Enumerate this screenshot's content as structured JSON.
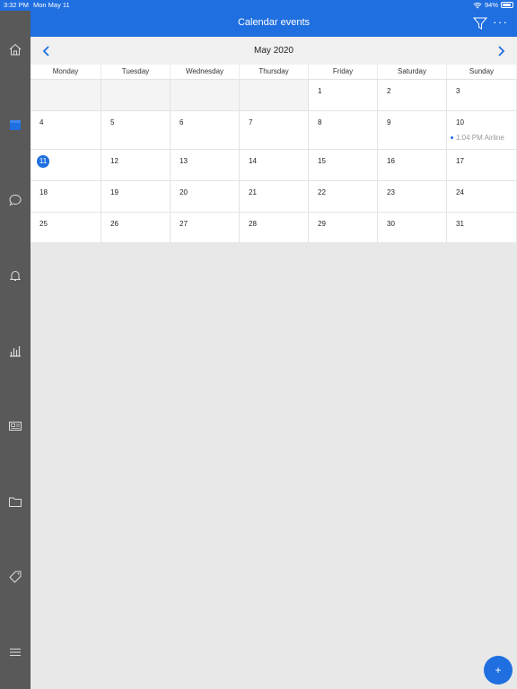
{
  "status": {
    "time": "3:32 PM",
    "date": "Mon May 11",
    "battery": "94%",
    "battery_level": 0.94
  },
  "header": {
    "title": "Calendar events"
  },
  "month": {
    "title": "May 2020"
  },
  "weekdays": [
    "Monday",
    "Tuesday",
    "Wednesday",
    "Thursday",
    "Friday",
    "Saturday",
    "Sunday"
  ],
  "weeks": [
    [
      "",
      "",
      "",
      "",
      "1",
      "2",
      "3"
    ],
    [
      "4",
      "5",
      "6",
      "7",
      "8",
      "9",
      "10"
    ],
    [
      "11",
      "12",
      "13",
      "14",
      "15",
      "16",
      "17"
    ],
    [
      "18",
      "19",
      "20",
      "21",
      "22",
      "23",
      "24"
    ],
    [
      "25",
      "26",
      "27",
      "28",
      "29",
      "30",
      "31"
    ]
  ],
  "today": "11",
  "events": [
    {
      "day": "10",
      "label": "1:04 PM Airline"
    }
  ],
  "fab": {
    "label": "+"
  },
  "colors": {
    "accent": "#1f6fe0",
    "sidebar": "#595959"
  },
  "sidebar_items": [
    "home-icon",
    "calendar-icon",
    "chat-icon",
    "bell-icon",
    "bar-chart-icon",
    "news-icon",
    "folder-icon",
    "tag-icon",
    "menu-icon"
  ]
}
